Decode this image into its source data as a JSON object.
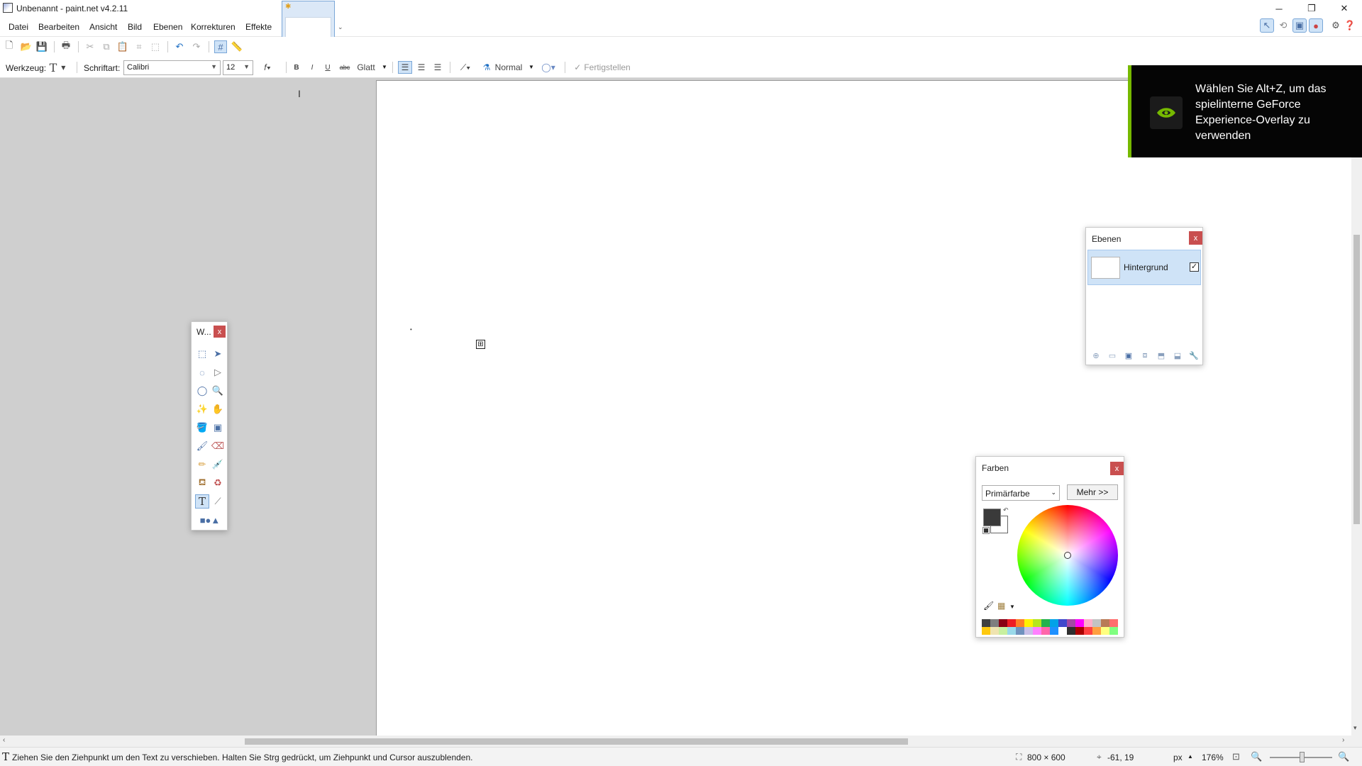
{
  "window": {
    "title": "Unbenannt - paint.net v4.2.11",
    "minimize_icon": "minimize-icon",
    "restore_icon": "restore-icon",
    "close_icon": "close-icon"
  },
  "menu": {
    "items": [
      "Datei",
      "Bearbeiten",
      "Ansicht",
      "Bild",
      "Ebenen",
      "Korrekturen",
      "Effekte"
    ]
  },
  "toolbar": {
    "tool_label": "Werkzeug:",
    "font_label": "Schriftart:",
    "font_value": "Calibri",
    "size_value": "12",
    "bold": "B",
    "italic": "I",
    "underline": "U",
    "strikethrough": "abc",
    "antialias_value": "Glatt",
    "blend_mode_value": "Normal",
    "finish_label": "Fertigstellen"
  },
  "overlay": {
    "text": "Wählen Sie Alt+Z, um das spielinterne GeForce Experience-Overlay zu verwenden",
    "accent_color": "#76b900"
  },
  "tools_panel": {
    "title": "W...",
    "close": "x"
  },
  "layers_panel": {
    "title": "Ebenen",
    "close": "x",
    "layers": [
      {
        "name": "Hintergrund",
        "visible": true
      }
    ]
  },
  "colors_panel": {
    "title": "Farben",
    "close": "x",
    "mode_value": "Primärfarbe",
    "more_label": "Mehr >>",
    "primary_color": "#3a3a3a",
    "secondary_color": "#ffffff"
  },
  "statusbar": {
    "hint": "Ziehen Sie den Ziehpunkt um den Text zu verschieben. Halten Sie Strg gedrückt, um Ziehpunkt und Cursor auszublenden.",
    "image_size": "800 × 600",
    "cursor_pos": "-61, 19",
    "units": "px",
    "zoom": "176%"
  },
  "palette": [
    "#404040",
    "#7f7f7f",
    "#880015",
    "#ed1c24",
    "#ff7f27",
    "#fff200",
    "#b5e61d",
    "#22b14c",
    "#00a2e8",
    "#3f48cc",
    "#a349a4",
    "#ff00ff",
    "#ffaec9",
    "#c3c3c3",
    "#b97a57",
    "#ff6e6e",
    "#ffc90e",
    "#efe4b0",
    "#c8f0a0",
    "#99d9ea",
    "#7092be",
    "#c8bfe7",
    "#ff80ff",
    "#ff66aa",
    "#1e90ff",
    "#ffffff",
    "#2f2f2f",
    "#aa0000",
    "#ff4040",
    "#ff9f40",
    "#ffff80",
    "#80ff80"
  ]
}
